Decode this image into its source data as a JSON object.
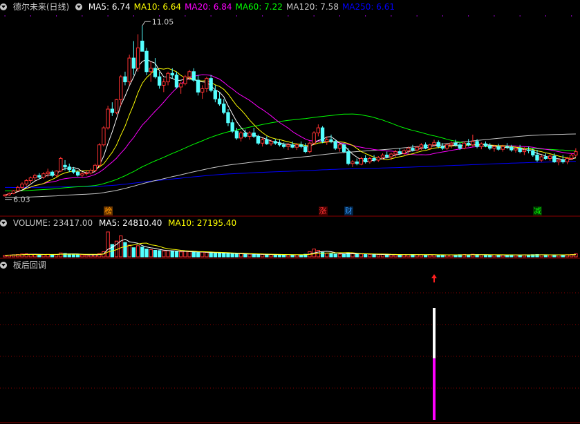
{
  "title": "德尔未来(日线)",
  "ma_labels": [
    {
      "text": "MA5: 6.74",
      "color": "#ffffff"
    },
    {
      "text": "MA10: 6.64",
      "color": "#ffff00"
    },
    {
      "text": "MA20: 6.84",
      "color": "#ff00ff"
    },
    {
      "text": "MA60: 7.22",
      "color": "#00ff00"
    },
    {
      "text": "MA120: 7.58",
      "color": "#c8c8c8"
    },
    {
      "text": "MA250: 6.61",
      "color": "#0000ff"
    }
  ],
  "high_label": "11.05",
  "low_label": "6.03",
  "event_tags": [
    {
      "text": "榜",
      "color": "#ff9900",
      "bg": "#663300",
      "index": 24
    },
    {
      "text": "涨",
      "color": "#ff3333",
      "bg": "#440000",
      "index": 74
    },
    {
      "text": "财",
      "color": "#3399ff",
      "bg": "#002244",
      "index": 80
    },
    {
      "text": "减",
      "color": "#00ff00",
      "bg": "#003300",
      "index": 124
    }
  ],
  "volume_header": {
    "volume": "VOLUME: 23417.00",
    "ma5": "MA5: 24810.40",
    "ma10": "MA10: 27195.40"
  },
  "indicator_header": "板后回调",
  "colors": {
    "up": "#ff3232",
    "down": "#54ffff",
    "ma5": "#ffffff",
    "ma10": "#ffff00",
    "ma20": "#ff00ff",
    "ma60": "#00ff00",
    "ma120": "#c8c8c8",
    "ma250": "#0000ff",
    "grid": "#8b0000"
  },
  "chart_data": {
    "type": "candlestick",
    "ylim": [
      5.8,
      11.4
    ],
    "ohlc": [
      [
        6.05,
        6.1,
        6.03,
        6.08
      ],
      [
        6.08,
        6.15,
        6.05,
        6.12
      ],
      [
        6.12,
        6.22,
        6.1,
        6.2
      ],
      [
        6.2,
        6.35,
        6.18,
        6.3
      ],
      [
        6.3,
        6.45,
        6.25,
        6.4
      ],
      [
        6.4,
        6.55,
        6.35,
        6.5
      ],
      [
        6.5,
        6.62,
        6.42,
        6.58
      ],
      [
        6.58,
        6.7,
        6.5,
        6.65
      ],
      [
        6.65,
        6.72,
        6.55,
        6.6
      ],
      [
        6.6,
        6.75,
        6.55,
        6.7
      ],
      [
        6.7,
        6.85,
        6.6,
        6.75
      ],
      [
        6.75,
        6.8,
        6.6,
        6.65
      ],
      [
        6.65,
        6.8,
        6.6,
        6.78
      ],
      [
        6.78,
        7.2,
        6.75,
        7.15
      ],
      [
        6.95,
        7.1,
        6.8,
        6.9
      ],
      [
        6.9,
        7.0,
        6.75,
        6.82
      ],
      [
        6.82,
        6.9,
        6.7,
        6.75
      ],
      [
        6.75,
        6.8,
        6.62,
        6.66
      ],
      [
        6.66,
        6.75,
        6.6,
        6.7
      ],
      [
        6.7,
        6.78,
        6.65,
        6.72
      ],
      [
        6.72,
        6.85,
        6.68,
        6.8
      ],
      [
        6.8,
        7.0,
        6.75,
        6.95
      ],
      [
        6.95,
        7.6,
        6.9,
        7.55
      ],
      [
        7.55,
        8.1,
        7.5,
        8.05
      ],
      [
        8.05,
        8.7,
        8.0,
        8.6
      ],
      [
        8.6,
        8.8,
        8.4,
        8.5
      ],
      [
        8.5,
        8.9,
        8.45,
        8.88
      ],
      [
        8.88,
        9.6,
        8.7,
        9.55
      ],
      [
        9.55,
        9.7,
        9.3,
        9.4
      ],
      [
        9.4,
        10.2,
        9.3,
        10.1
      ],
      [
        10.1,
        10.6,
        9.6,
        9.8
      ],
      [
        9.8,
        10.8,
        9.7,
        10.4
      ],
      [
        10.6,
        11.05,
        10.3,
        10.3
      ],
      [
        10.3,
        10.4,
        9.6,
        9.7
      ],
      [
        9.7,
        10.0,
        9.4,
        9.8
      ],
      [
        9.8,
        10.1,
        9.5,
        9.55
      ],
      [
        9.55,
        9.7,
        9.2,
        9.3
      ],
      [
        9.3,
        9.5,
        9.1,
        9.4
      ],
      [
        9.4,
        9.7,
        9.3,
        9.65
      ],
      [
        9.65,
        9.8,
        9.5,
        9.6
      ],
      [
        9.6,
        9.7,
        9.2,
        9.25
      ],
      [
        9.25,
        9.4,
        9.05,
        9.35
      ],
      [
        9.35,
        9.6,
        9.3,
        9.55
      ],
      [
        9.55,
        9.75,
        9.45,
        9.7
      ],
      [
        9.7,
        9.8,
        9.4,
        9.45
      ],
      [
        9.45,
        9.6,
        9.0,
        9.1
      ],
      [
        9.1,
        9.3,
        8.9,
        9.2
      ],
      [
        9.2,
        9.55,
        9.1,
        9.5
      ],
      [
        9.5,
        9.6,
        9.1,
        9.15
      ],
      [
        9.15,
        9.3,
        8.8,
        8.9
      ],
      [
        8.9,
        9.1,
        8.7,
        8.75
      ],
      [
        8.75,
        8.9,
        8.45,
        8.5
      ],
      [
        8.5,
        8.6,
        8.1,
        8.2
      ],
      [
        8.2,
        8.3,
        7.9,
        7.95
      ],
      [
        7.95,
        8.05,
        7.7,
        7.75
      ],
      [
        7.75,
        7.95,
        7.65,
        7.9
      ],
      [
        7.9,
        8.0,
        7.75,
        7.8
      ],
      [
        7.8,
        7.95,
        7.7,
        7.9
      ],
      [
        7.9,
        8.05,
        7.75,
        7.8
      ],
      [
        7.8,
        7.85,
        7.55,
        7.6
      ],
      [
        7.6,
        7.75,
        7.5,
        7.7
      ],
      [
        7.7,
        7.8,
        7.55,
        7.58
      ],
      [
        7.58,
        7.7,
        7.52,
        7.65
      ],
      [
        7.65,
        7.72,
        7.55,
        7.6
      ],
      [
        7.6,
        7.7,
        7.5,
        7.55
      ],
      [
        7.55,
        7.62,
        7.45,
        7.5
      ],
      [
        7.5,
        7.6,
        7.4,
        7.55
      ],
      [
        7.55,
        7.65,
        7.45,
        7.48
      ],
      [
        7.48,
        7.6,
        7.4,
        7.55
      ],
      [
        7.55,
        7.65,
        7.45,
        7.5
      ],
      [
        7.5,
        7.6,
        7.3,
        7.35
      ],
      [
        7.35,
        7.65,
        7.3,
        7.6
      ],
      [
        7.6,
        7.95,
        7.55,
        7.9
      ],
      [
        7.9,
        8.15,
        7.8,
        8.05
      ],
      [
        8.05,
        8.1,
        7.6,
        7.65
      ],
      [
        7.65,
        7.8,
        7.55,
        7.7
      ],
      [
        7.7,
        7.85,
        7.6,
        7.65
      ],
      [
        7.65,
        7.7,
        7.4,
        7.45
      ],
      [
        7.45,
        7.6,
        7.35,
        7.55
      ],
      [
        7.55,
        7.6,
        7.3,
        7.35
      ],
      [
        7.35,
        7.45,
        6.95,
        7.0
      ],
      [
        7.0,
        7.1,
        6.9,
        7.05
      ],
      [
        7.05,
        7.15,
        6.95,
        7.0
      ],
      [
        6.98,
        7.2,
        6.95,
        7.15
      ],
      [
        7.15,
        7.25,
        7.0,
        7.05
      ],
      [
        7.05,
        7.2,
        7.0,
        7.15
      ],
      [
        7.15,
        7.25,
        7.05,
        7.1
      ],
      [
        7.1,
        7.22,
        7.05,
        7.18
      ],
      [
        7.18,
        7.3,
        7.12,
        7.25
      ],
      [
        7.25,
        7.35,
        7.15,
        7.2
      ],
      [
        7.2,
        7.32,
        7.1,
        7.28
      ],
      [
        7.28,
        7.4,
        7.2,
        7.35
      ],
      [
        7.35,
        7.45,
        7.25,
        7.3
      ],
      [
        7.3,
        7.42,
        7.25,
        7.38
      ],
      [
        7.38,
        7.5,
        7.3,
        7.45
      ],
      [
        7.45,
        7.55,
        7.35,
        7.4
      ],
      [
        7.4,
        7.52,
        7.35,
        7.48
      ],
      [
        7.48,
        7.6,
        7.4,
        7.55
      ],
      [
        7.55,
        7.62,
        7.42,
        7.45
      ],
      [
        7.45,
        7.58,
        7.4,
        7.55
      ],
      [
        7.55,
        7.7,
        7.5,
        7.62
      ],
      [
        7.62,
        7.68,
        7.45,
        7.5
      ],
      [
        7.5,
        7.6,
        7.4,
        7.45
      ],
      [
        7.45,
        7.58,
        7.4,
        7.55
      ],
      [
        7.55,
        7.65,
        7.45,
        7.6
      ],
      [
        7.6,
        7.7,
        7.5,
        7.55
      ],
      [
        7.55,
        7.62,
        7.4,
        7.45
      ],
      [
        7.45,
        7.65,
        7.42,
        7.6
      ],
      [
        7.6,
        7.72,
        7.5,
        7.55
      ],
      [
        7.55,
        7.85,
        7.5,
        7.65
      ],
      [
        7.65,
        7.72,
        7.45,
        7.5
      ],
      [
        7.5,
        7.62,
        7.42,
        7.58
      ],
      [
        7.58,
        7.65,
        7.48,
        7.52
      ],
      [
        7.52,
        7.6,
        7.4,
        7.45
      ],
      [
        7.45,
        7.55,
        7.35,
        7.5
      ],
      [
        7.5,
        7.58,
        7.38,
        7.42
      ],
      [
        7.42,
        7.55,
        7.35,
        7.5
      ],
      [
        7.5,
        7.6,
        7.42,
        7.48
      ],
      [
        7.48,
        7.55,
        7.35,
        7.4
      ],
      [
        7.4,
        7.52,
        7.32,
        7.45
      ],
      [
        7.45,
        7.55,
        7.3,
        7.35
      ],
      [
        7.35,
        7.48,
        7.25,
        7.4
      ],
      [
        7.4,
        7.5,
        7.3,
        7.38
      ],
      [
        7.38,
        7.45,
        7.2,
        7.25
      ],
      [
        7.25,
        7.4,
        7.05,
        7.1
      ],
      [
        7.1,
        7.25,
        7.05,
        7.2
      ],
      [
        7.2,
        7.3,
        7.1,
        7.15
      ],
      [
        7.15,
        7.28,
        7.08,
        7.22
      ],
      [
        7.22,
        7.3,
        7.02,
        7.05
      ],
      [
        7.05,
        7.15,
        6.95,
        7.1
      ],
      [
        7.1,
        7.25,
        7.0,
        7.05
      ],
      [
        7.05,
        7.2,
        6.98,
        7.15
      ],
      [
        7.15,
        7.3,
        7.1,
        7.25
      ],
      [
        7.25,
        7.45,
        7.2,
        7.35
      ]
    ],
    "volume_max": 200000,
    "volume": [
      12000,
      14000,
      16000,
      18000,
      22000,
      24000,
      20000,
      18000,
      16000,
      18000,
      20000,
      17000,
      19000,
      30000,
      26000,
      22000,
      18000,
      16000,
      15000,
      14000,
      16000,
      18000,
      25000,
      40000,
      190000,
      95000,
      120000,
      160000,
      110000,
      90000,
      70000,
      85000,
      75000,
      60000,
      55000,
      50000,
      48000,
      45000,
      47000,
      44000,
      40000,
      38000,
      42000,
      40000,
      35000,
      33000,
      36000,
      34000,
      30000,
      28000,
      30000,
      28000,
      26000,
      24000,
      22000,
      24000,
      20000,
      21000,
      20000,
      18000,
      19000,
      18000,
      17000,
      18000,
      16000,
      17000,
      16000,
      15000,
      16000,
      15000,
      20000,
      40000,
      60000,
      50000,
      35000,
      28000,
      25000,
      22000,
      21000,
      20000,
      30000,
      26000,
      24000,
      22000,
      20000,
      19000,
      18000,
      17000,
      18000,
      16000,
      17000,
      16000,
      18000,
      17000,
      16000,
      18000,
      17000,
      16000,
      15000,
      17000,
      16000,
      15000,
      14000,
      15000,
      16000,
      15000,
      17000,
      18000,
      16000,
      20000,
      17000,
      16000,
      15000,
      14000,
      16000,
      15000,
      14000,
      15000,
      16000,
      15000,
      14000,
      16000,
      15000,
      17000,
      18000,
      16000,
      15000,
      14000,
      15000,
      16000,
      15000,
      17000,
      18000,
      23417
    ],
    "signal_index": 100,
    "signal_white_top": 0.0,
    "signal_white_bottom": 0.45,
    "signal_magenta_bottom": 1.0
  }
}
